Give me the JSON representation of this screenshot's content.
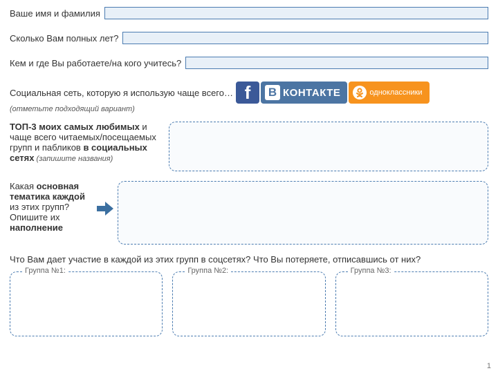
{
  "fields": {
    "name_label": "Ваше имя и фамилия",
    "age_label": "Сколько Вам полных лет?",
    "work_label": "Кем и где Вы работаете/на кого учитесь?"
  },
  "social": {
    "label": "Социальная сеть, которую я использую чаще всего…",
    "hint": "(отметьте подходящий вариант)",
    "fb": "f",
    "vk_b": "B",
    "vk_text": "КОНТАКТЕ",
    "ok_text": "одноклассники"
  },
  "top3": {
    "line1": "ТОП-3 моих самых любимых",
    "line2": " и чаще всего читаемых/посещаемых групп и пабликов ",
    "line3": "в социальных сетях",
    "hint": " (запишите названия)"
  },
  "theme": {
    "q1": "Какая ",
    "q2": "основная тематика каждой",
    "q3": " из этих групп? Опишите их ",
    "q4": "наполнение"
  },
  "question_full": "Что Вам дает участие в каждой из этих групп в соцсетях? Что Вы потеряете, отписавшись от них?",
  "groups": {
    "g1": "Группа №1:",
    "g2": "Группа №2:",
    "g3": "Группа №3:"
  },
  "page": "1"
}
